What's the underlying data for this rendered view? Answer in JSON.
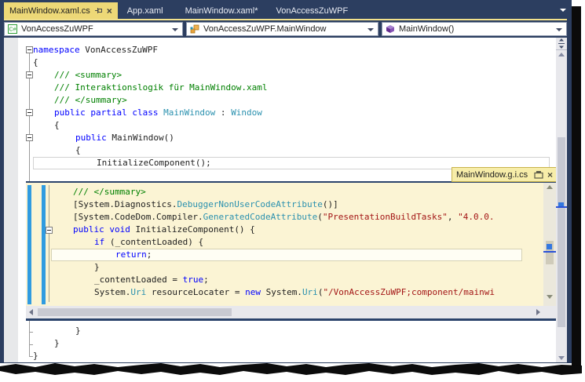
{
  "tabs": {
    "active": "MainWindow.xaml.cs",
    "items": [
      "App.xaml",
      "MainWindow.xaml*",
      "VonAccessZuWPF"
    ]
  },
  "navbar": {
    "project": "VonAccessZuWPF",
    "type": "VonAccessZuWPF.MainWindow",
    "member": "MainWindow()"
  },
  "peek": {
    "title": "MainWindow.g.i.cs"
  },
  "code": {
    "main": [
      {
        "ind": 0,
        "seg": [
          {
            "c": "k",
            "t": "namespace "
          },
          {
            "c": "p",
            "t": "VonAccessZuWPF"
          }
        ]
      },
      {
        "ind": 0,
        "seg": [
          {
            "c": "p",
            "t": "{"
          }
        ]
      },
      {
        "ind": 1,
        "seg": [
          {
            "c": "c",
            "t": "/// <summary>"
          }
        ]
      },
      {
        "ind": 1,
        "seg": [
          {
            "c": "c",
            "t": "/// Interaktionslogik für MainWindow.xaml"
          }
        ]
      },
      {
        "ind": 1,
        "seg": [
          {
            "c": "c",
            "t": "/// </summary>"
          }
        ]
      },
      {
        "ind": 1,
        "seg": [
          {
            "c": "k",
            "t": "public partial class "
          },
          {
            "c": "t",
            "t": "MainWindow"
          },
          {
            "c": "p",
            "t": " : "
          },
          {
            "c": "t",
            "t": "Window"
          }
        ]
      },
      {
        "ind": 1,
        "seg": [
          {
            "c": "p",
            "t": "{"
          }
        ]
      },
      {
        "ind": 2,
        "seg": [
          {
            "c": "k",
            "t": "public "
          },
          {
            "c": "p",
            "t": "MainWindow()"
          }
        ]
      },
      {
        "ind": 2,
        "seg": [
          {
            "c": "p",
            "t": "{"
          }
        ]
      },
      {
        "ind": 3,
        "hl": true,
        "seg": [
          {
            "c": "p",
            "t": "InitializeComponent();"
          }
        ]
      }
    ],
    "peek": [
      {
        "ind": 0,
        "seg": [
          {
            "c": "c",
            "t": "/// </summary>"
          }
        ]
      },
      {
        "ind": 0,
        "seg": [
          {
            "c": "p",
            "t": "[System.Diagnostics."
          },
          {
            "c": "t",
            "t": "DebuggerNonUserCodeAttribute"
          },
          {
            "c": "p",
            "t": "()]"
          }
        ]
      },
      {
        "ind": 0,
        "seg": [
          {
            "c": "p",
            "t": "[System.CodeDom.Compiler."
          },
          {
            "c": "t",
            "t": "GeneratedCodeAttribute"
          },
          {
            "c": "p",
            "t": "("
          },
          {
            "c": "s",
            "t": "\"PresentationBuildTasks\""
          },
          {
            "c": "p",
            "t": ", "
          },
          {
            "c": "s",
            "t": "\"4.0.0."
          }
        ]
      },
      {
        "ind": 0,
        "seg": [
          {
            "c": "k",
            "t": "public void "
          },
          {
            "c": "p",
            "t": "InitializeComponent() {"
          }
        ]
      },
      {
        "ind": 1,
        "seg": [
          {
            "c": "k",
            "t": "if "
          },
          {
            "c": "p",
            "t": "(_contentLoaded) {"
          }
        ]
      },
      {
        "ind": 2,
        "hl": true,
        "seg": [
          {
            "c": "k",
            "t": "return"
          },
          {
            "c": "p",
            "t": ";"
          }
        ]
      },
      {
        "ind": 1,
        "seg": [
          {
            "c": "p",
            "t": "}"
          }
        ]
      },
      {
        "ind": 1,
        "seg": [
          {
            "c": "p",
            "t": "_contentLoaded = "
          },
          {
            "c": "k",
            "t": "true"
          },
          {
            "c": "p",
            "t": ";"
          }
        ]
      },
      {
        "ind": 1,
        "seg": [
          {
            "c": "p",
            "t": "System."
          },
          {
            "c": "t",
            "t": "Uri"
          },
          {
            "c": "p",
            "t": " resourceLocater = "
          },
          {
            "c": "k",
            "t": "new"
          },
          {
            "c": "p",
            "t": " System."
          },
          {
            "c": "t",
            "t": "Uri"
          },
          {
            "c": "p",
            "t": "("
          },
          {
            "c": "s",
            "t": "\"/VonAccessZuWPF;component/mainwi"
          }
        ]
      }
    ],
    "after": [
      {
        "ind": 2,
        "seg": [
          {
            "c": "p",
            "t": "}"
          }
        ]
      },
      {
        "ind": 1,
        "seg": [
          {
            "c": "p",
            "t": "}"
          }
        ]
      },
      {
        "ind": 0,
        "seg": [
          {
            "c": "p",
            "t": "}"
          }
        ]
      }
    ]
  },
  "colors": {
    "chrome": "#2c3e60",
    "active_tab": "#edd877",
    "peek_header": "#f7eda9",
    "peek_bg": "#fbf4d4",
    "keyword": "#0000ff",
    "comment": "#008000",
    "type": "#2b91af",
    "string": "#a31515",
    "change_bar": "#309be0",
    "caret_marker": "#2a52d8"
  }
}
